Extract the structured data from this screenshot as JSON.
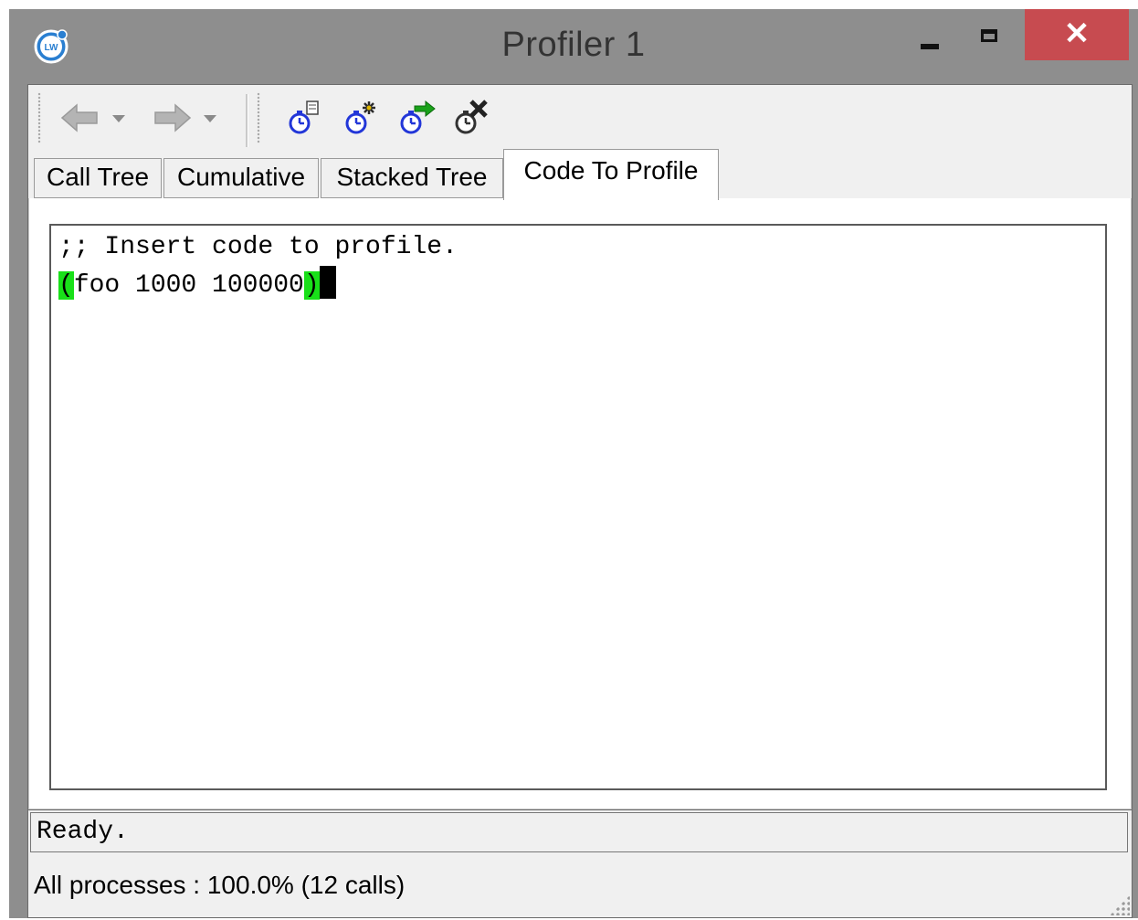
{
  "window": {
    "title": "Profiler 1",
    "close_glyph": "✕"
  },
  "toolbar": {
    "icons": [
      "back-arrow-icon",
      "forward-arrow-icon",
      "profile-settings-icon",
      "profile-start-icon",
      "profile-run-icon",
      "profile-clear-icon"
    ]
  },
  "tabs": [
    {
      "label": "Call Tree"
    },
    {
      "label": "Cumulative"
    },
    {
      "label": "Stacked Tree"
    },
    {
      "label": "Code To Profile"
    }
  ],
  "editor": {
    "line1": ";; Insert code to profile.",
    "line2_open": "(",
    "line2_body": "foo 1000 100000",
    "line2_close": ")"
  },
  "status": {
    "message": "Ready.",
    "info": "All processes : 100.0% (12 calls)"
  },
  "colors": {
    "titlebar": "#8e8e8e",
    "close_button": "#c74b50",
    "paren_highlight": "#19e019"
  }
}
